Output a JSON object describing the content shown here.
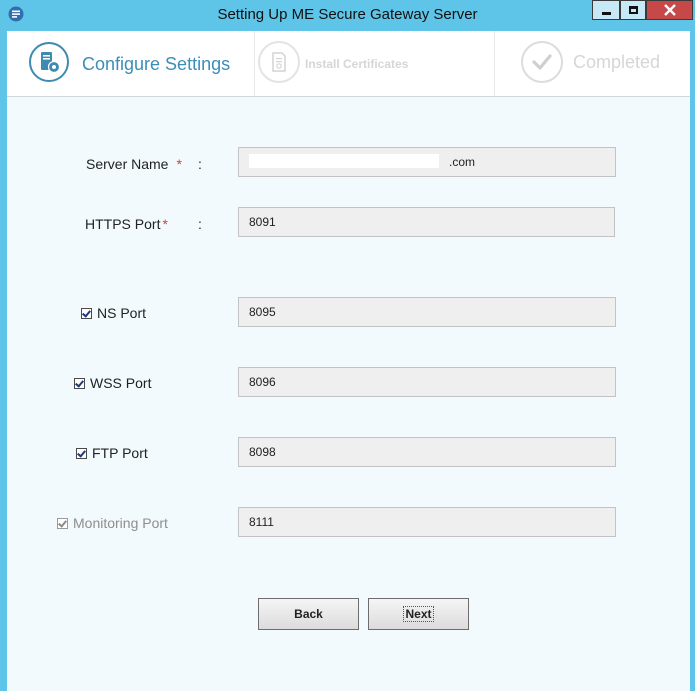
{
  "window": {
    "title": "Setting Up ME Secure Gateway Server"
  },
  "steps": [
    {
      "label": "Configure Settings",
      "state": "active",
      "icon": "server-gear-icon"
    },
    {
      "label": "Install Certificates",
      "state": "inactive",
      "icon": "certificate-icon"
    },
    {
      "label": "Completed",
      "state": "inactive",
      "icon": "checkmark-icon"
    }
  ],
  "form": {
    "server_name": {
      "label": "Server Name",
      "required_mark": "*",
      "colon": ":",
      "value_suffix": "   .com"
    },
    "https_port": {
      "label": "HTTPS Port",
      "required_mark": "*",
      "colon": ":",
      "value": "8091"
    },
    "ports": [
      {
        "label": "NS Port",
        "checked": true,
        "enabled": true,
        "value": "8095"
      },
      {
        "label": "WSS Port",
        "checked": true,
        "enabled": true,
        "value": "8096"
      },
      {
        "label": "FTP Port",
        "checked": true,
        "enabled": true,
        "value": "8098"
      },
      {
        "label": "Monitoring Port",
        "checked": true,
        "enabled": false,
        "value": "8111"
      }
    ]
  },
  "buttons": {
    "back": "Back",
    "next": "Next"
  },
  "colors": {
    "window_frame": "#5fc5e8",
    "active_step": "#3a8eb8",
    "required": "#e03b2a",
    "close_button": "#c74848"
  }
}
